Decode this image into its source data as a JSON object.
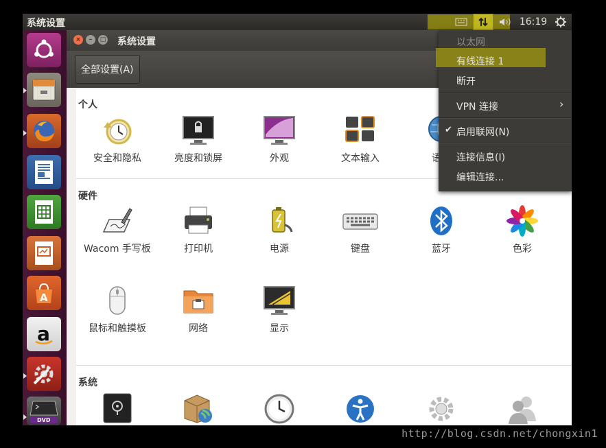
{
  "topbar": {
    "app_title": "系统设置",
    "time": "16:19"
  },
  "window": {
    "title": "系统设置",
    "toolbar": {
      "all_settings_label": "全部设置(A)"
    }
  },
  "sections": [
    {
      "title": "个人",
      "items": [
        {
          "label": "安全和隐私",
          "icon": "security-privacy-icon"
        },
        {
          "label": "亮度和锁屏",
          "icon": "brightness-lock-icon"
        },
        {
          "label": "外观",
          "icon": "appearance-icon"
        },
        {
          "label": "文本输入",
          "icon": "text-entry-icon"
        },
        {
          "label": "语言",
          "icon": "language-icon"
        }
      ]
    },
    {
      "title": "硬件",
      "items": [
        {
          "label": "Wacom 手写板",
          "icon": "wacom-tablet-icon"
        },
        {
          "label": "打印机",
          "icon": "printer-icon"
        },
        {
          "label": "电源",
          "icon": "power-icon"
        },
        {
          "label": "键盘",
          "icon": "keyboard-icon"
        },
        {
          "label": "蓝牙",
          "icon": "bluetooth-icon"
        },
        {
          "label": "色彩",
          "icon": "color-icon"
        },
        {
          "label": "鼠标和触摸板",
          "icon": "mouse-touchpad-icon"
        },
        {
          "label": "网络",
          "icon": "network-icon"
        },
        {
          "label": "显示",
          "icon": "display-icon"
        }
      ]
    },
    {
      "title": "系统",
      "items": [
        {
          "icon": "backups-icon"
        },
        {
          "icon": "software-updates-icon"
        },
        {
          "icon": "time-date-icon"
        },
        {
          "icon": "universal-access-icon"
        },
        {
          "icon": "details-icon"
        },
        {
          "icon": "user-accounts-icon"
        }
      ]
    }
  ],
  "network_menu": {
    "ethernet_header": "以太网",
    "wired_connection": "有线连接 1",
    "disconnect": "断开",
    "vpn": "VPN 连接",
    "enable_networking": "启用联网(N)",
    "connection_info": "连接信息(I)",
    "edit_connections": "编辑连接..."
  },
  "launcher": [
    "ubuntu-dash-icon",
    "files-icon",
    "firefox-icon",
    "writer-icon",
    "calc-icon",
    "impress-icon",
    "software-center-icon",
    "amazon-icon",
    "system-settings-icon",
    "dvd-icon"
  ],
  "watermark": "http://blog.csdn.net/chongxin1",
  "colors": {
    "highlight": "#c8be00",
    "launcher": "#4a1838",
    "menu": "#3c3b37"
  }
}
